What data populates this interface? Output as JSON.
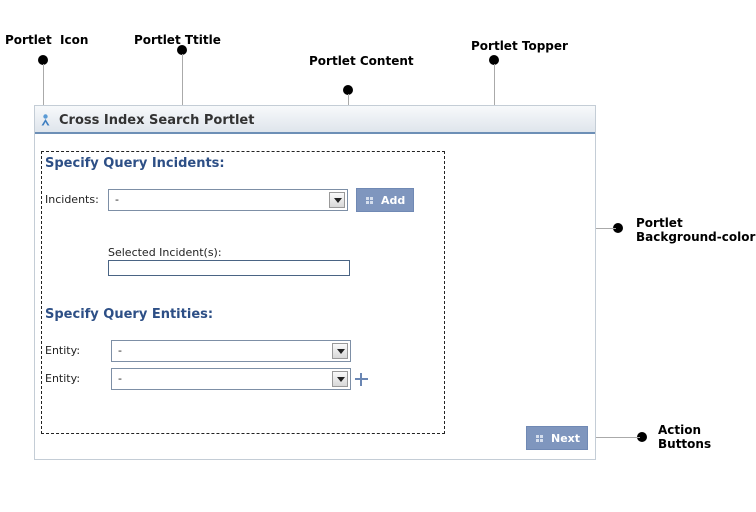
{
  "annotations": {
    "portlet_icon": "Portlet  Icon",
    "portlet_title": "Portlet Ttitle",
    "portlet_content": "Portlet Content",
    "portlet_topper": "Portlet Topper",
    "portlet_background": "Portlet\nBackground-color",
    "action_buttons": "Action\nButtons"
  },
  "portlet": {
    "title": "Cross Index Search Portlet",
    "icon": "person-icon",
    "incidents_section": {
      "heading": "Specify Query Incidents:",
      "incidents_label": "Incidents:",
      "incidents_value": "-",
      "add_label": "Add",
      "selected_label": "Selected Incident(s):",
      "selected_value": ""
    },
    "entities_section": {
      "heading": "Specify Query Entities:",
      "entity_rows": [
        {
          "label": "Entity:",
          "value": "-"
        },
        {
          "label": "Entity:",
          "value": "-"
        }
      ]
    },
    "next_label": "Next"
  },
  "colors": {
    "heading": "#2d4f86",
    "button": "#7f96be",
    "topper_border": "#6d8fb6"
  }
}
